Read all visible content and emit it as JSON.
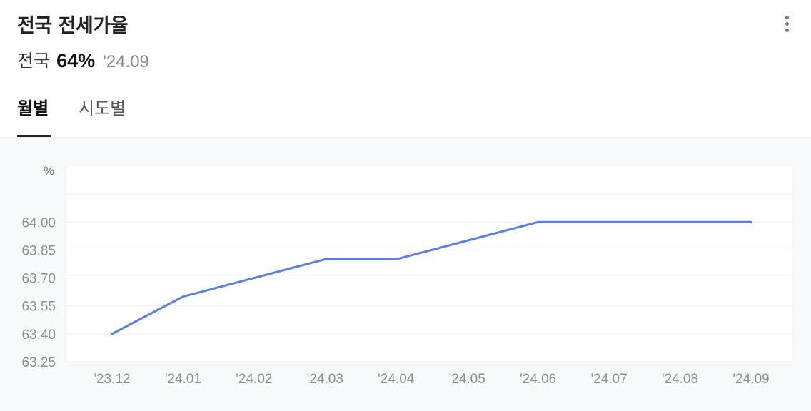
{
  "header": {
    "title": "전국 전세가율",
    "more_icon": "more-vertical-icon"
  },
  "summary": {
    "region": "전국",
    "value": "64%",
    "date": "'24.09"
  },
  "tabs": [
    {
      "label": "월별",
      "active": true
    },
    {
      "label": "시도별",
      "active": false
    }
  ],
  "colors": {
    "line": "#5b7fdc",
    "grid": "#eceef2",
    "axis_text": "#8a8e96"
  },
  "chart_data": {
    "type": "line",
    "title": "",
    "xlabel": "",
    "ylabel": "%",
    "categories": [
      "'23.12",
      "'24.01",
      "'24.02",
      "'24.03",
      "'24.04",
      "'24.05",
      "'24.06",
      "'24.07",
      "'24.08",
      "'24.09"
    ],
    "series": [
      {
        "values": [
          63.4,
          63.6,
          63.7,
          63.8,
          63.8,
          63.9,
          64.0,
          64.0,
          64.0,
          64.0
        ]
      }
    ],
    "yticks": [
      "64.00",
      "63.85",
      "63.70",
      "63.55",
      "63.40",
      "63.25"
    ],
    "ylim": [
      63.25,
      64.3
    ],
    "grid": true,
    "legend": "none"
  }
}
